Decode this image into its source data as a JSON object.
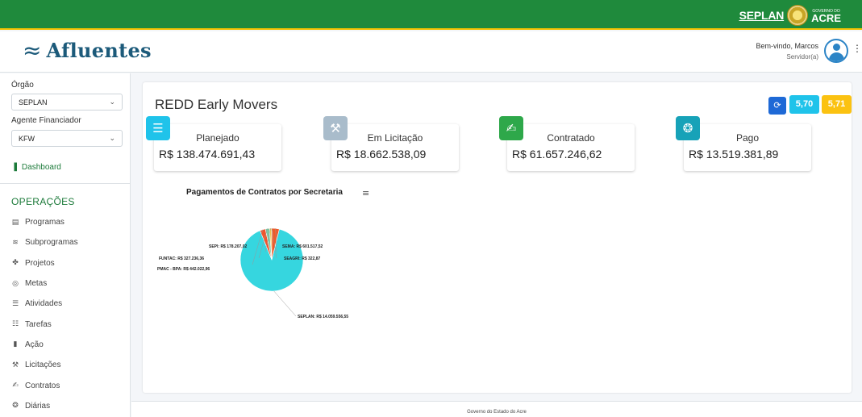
{
  "topbar": {
    "brand_left": "SEPLAN",
    "brand_right": "ACRE",
    "brand_right_small": "GOVERNO DO"
  },
  "header": {
    "app_name": "Afluentes",
    "welcome": "Bem-vindo, Marcos",
    "role": "Servidor(a)"
  },
  "sidebar": {
    "orgao_label": "Órgão",
    "orgao_value": "SEPLAN",
    "agente_label": "Agente Financiador",
    "agente_value": "KFW",
    "dashboard": "Dashboard",
    "section_title": "OPERAÇÕES",
    "items": [
      {
        "label": "Programas",
        "icon": "book-icon"
      },
      {
        "label": "Subprogramas",
        "icon": "layers-icon"
      },
      {
        "label": "Projetos",
        "icon": "tasks-icon"
      },
      {
        "label": "Metas",
        "icon": "target-icon"
      },
      {
        "label": "Atividades",
        "icon": "list-icon"
      },
      {
        "label": "Tarefas",
        "icon": "checklist-icon"
      },
      {
        "label": "Ação",
        "icon": "clipboard-icon"
      },
      {
        "label": "Licitações",
        "icon": "gavel-icon"
      },
      {
        "label": "Contratos",
        "icon": "signature-icon"
      },
      {
        "label": "Diárias",
        "icon": "money-icon"
      }
    ]
  },
  "main": {
    "title": "REDD Early Movers",
    "badge_a": "5,70",
    "badge_b": "5,71",
    "stats": [
      {
        "label": "Planejado",
        "value": "R$ 138.474.691,43",
        "color": "#1fc3ea"
      },
      {
        "label": "Em Licitação",
        "value": "R$ 18.662.538,09",
        "color": "#a9bccb"
      },
      {
        "label": "Contratado",
        "value": "R$ 61.657.246,62",
        "color": "#2ea84a"
      },
      {
        "label": "Pago",
        "value": "R$ 13.519.381,89",
        "color": "#17a2b8"
      }
    ],
    "chart_title": "Pagamentos de Contratos por Secretaria"
  },
  "chart_data": {
    "type": "pie",
    "title": "Pagamentos de Contratos por Secretaria",
    "slices": [
      {
        "label": "SEPLAN: R$ 14.059.556,55",
        "value": 14059556.55,
        "color": "#36d6df"
      },
      {
        "label": "PMAC - BPA: R$ 442.022,96",
        "value": 442022.96,
        "color": "#f2542d"
      },
      {
        "label": "FUNTAC: R$ 327.236,36",
        "value": 327236.36,
        "color": "#7cc7a4"
      },
      {
        "label": "SEPI: R$ 178.207,02",
        "value": 178207.02,
        "color": "#f3c148"
      },
      {
        "label": "SEMA: R$ 601.517,52",
        "value": 601517.52,
        "color": "#f05a28"
      },
      {
        "label": "SEAGRI: R$ 322,87",
        "value": 322.87,
        "color": "#2a3f54"
      }
    ]
  },
  "footer": {
    "text": "Governo do Estado do Acre"
  }
}
